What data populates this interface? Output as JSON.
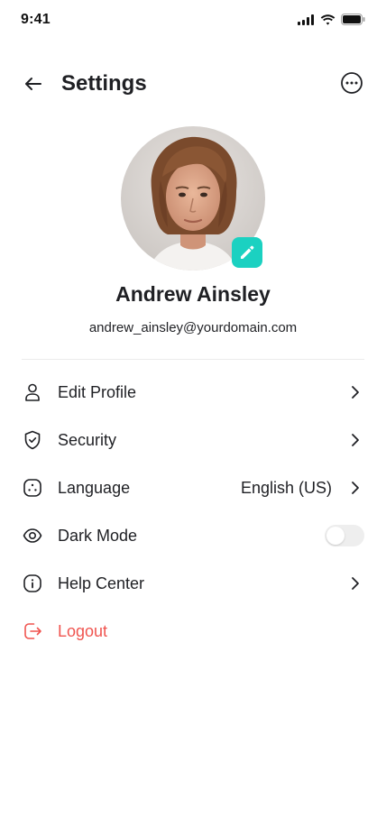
{
  "status_bar": {
    "time": "9:41"
  },
  "header": {
    "title": "Settings"
  },
  "profile": {
    "name": "Andrew Ainsley",
    "email": "andrew_ainsley@yourdomain.com"
  },
  "menu": [
    {
      "label": "Edit Profile",
      "icon": "person-icon"
    },
    {
      "label": "Security",
      "icon": "shield-icon"
    },
    {
      "label": "Language",
      "value": "English (US)",
      "icon": "language-icon"
    },
    {
      "label": "Dark Mode",
      "icon": "eye-icon",
      "toggle_on": false
    },
    {
      "label": "Help Center",
      "icon": "info-icon"
    },
    {
      "label": "Logout",
      "icon": "logout-icon"
    }
  ],
  "colors": {
    "accent": "#1bd1c1",
    "danger": "#f0544f",
    "text": "#1f2024",
    "divider": "#ececec"
  }
}
